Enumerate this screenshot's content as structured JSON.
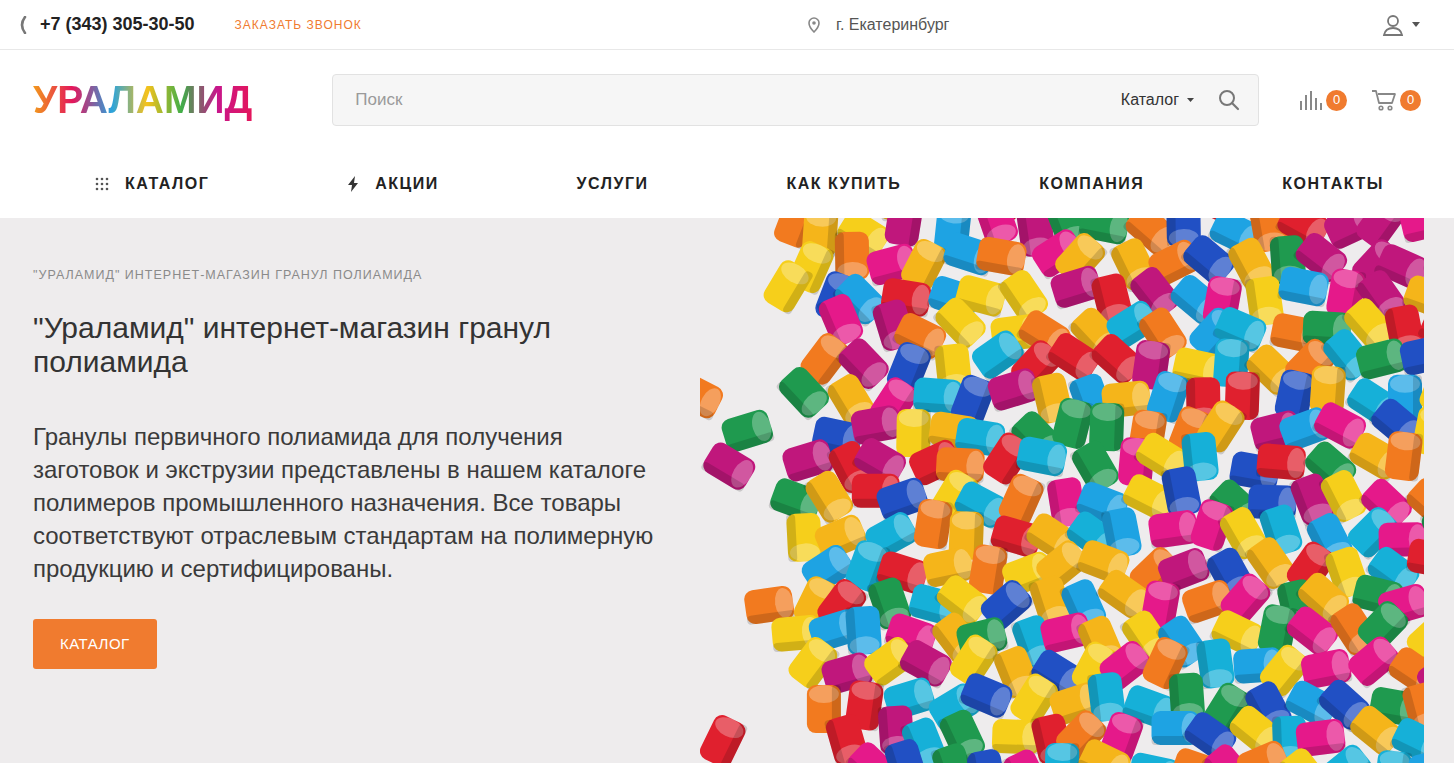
{
  "topbar": {
    "phone": "+7 (343) 305-30-50",
    "callback": "ЗАКАЗАТЬ ЗВОНОК",
    "city": "г. Екатеринбург"
  },
  "header": {
    "logo": "УРАЛАМИД",
    "search": {
      "placeholder": "Поиск",
      "scope": "Каталог"
    },
    "compare": {
      "count": "0"
    },
    "cart": {
      "count": "0"
    }
  },
  "nav": [
    {
      "label": "КАТАЛОГ",
      "kind": "menu"
    },
    {
      "label": "АКЦИИ",
      "kind": "promo"
    },
    {
      "label": "УСЛУГИ",
      "kind": "link"
    },
    {
      "label": "КАК КУПИТЬ",
      "kind": "link"
    },
    {
      "label": "КОМПАНИЯ",
      "kind": "link"
    },
    {
      "label": "КОНТАКТЫ",
      "kind": "link"
    }
  ],
  "hero": {
    "eyebrow": "\"УРАЛАМИД\" ИНТЕРНЕТ-МАГАЗИН ГРАНУЛ ПОЛИАМИДА",
    "title": "\"Ураламид\" интернет-магазин гранул полиамида",
    "text": "Гранулы первичного полиамида для получения заготовок и экструзии представлены в нашем каталоге полимеров промышленного назначения. Все товары соответствуют отраслевым стандартам на полимерную продукцию и сертифицированы.",
    "button": "КАТАЛОГ"
  }
}
